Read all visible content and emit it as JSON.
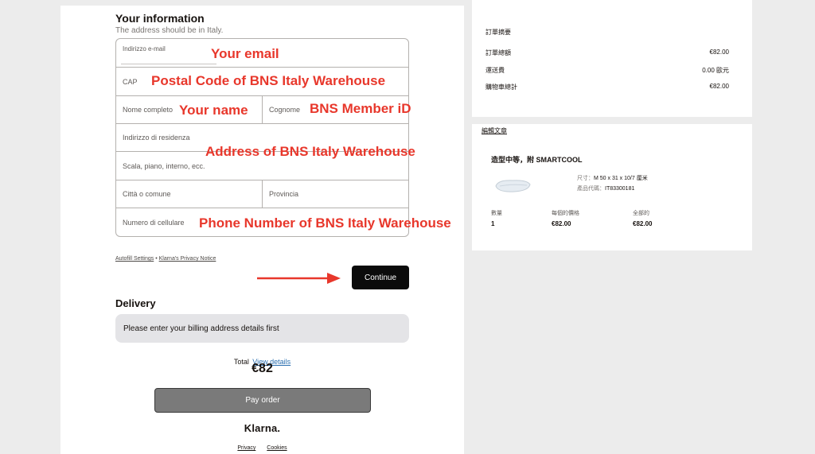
{
  "your_information": {
    "title": "Your information",
    "subtitle": "The address should be in Italy.",
    "fields": {
      "email_label": "Indirizzo e-mail",
      "cap": "CAP",
      "full_name": "Nome completo",
      "surname": "Cognome",
      "residence": "Indirizzo di residenza",
      "scala": "Scala, piano, interno, ecc.",
      "city": "Città o comune",
      "province": "Provincia",
      "phone": "Numero di cellulare"
    }
  },
  "annotations": {
    "email": "Your email",
    "cap": "Postal Code of BNS Italy Warehouse",
    "name": "Your name",
    "member": "BNS Member iD",
    "address": "Address of BNS Italy Warehouse",
    "phone": "Phone Number of BNS Italy Warehouse"
  },
  "links": {
    "autofill": "Autofill Settings",
    "separator": "•",
    "privacy_notice": "Klarna's Privacy Notice"
  },
  "continue_label": "Continue",
  "delivery": {
    "title": "Delivery",
    "notice": "Please enter your billing address details first"
  },
  "total": {
    "label": "Total",
    "view_details": "View details",
    "amount": "€82"
  },
  "pay_label": "Pay order",
  "brand": "Klarna.",
  "footer": {
    "privacy": "Privacy",
    "cookies": "Cookies"
  },
  "summary": {
    "title": "訂單摘要",
    "rows": [
      {
        "label": "訂單總額",
        "value": "€82.00"
      },
      {
        "label": "運送費",
        "value": "0.00 歐元"
      },
      {
        "label": "購物車總計",
        "value": "€82.00"
      }
    ]
  },
  "product": {
    "edit_link": "編輯文章",
    "name": "造型中等，附 SMARTCOOL",
    "size_label": "尺寸：",
    "size_value": "M 50 x 31 x 10/7 厘米",
    "code_label": "產品代碼：",
    "code_value": "IT83300181",
    "headers": {
      "qty": "數量",
      "unit": "每個的價格",
      "total": "全部的"
    },
    "values": {
      "qty": "1",
      "unit": "€82.00",
      "total": "€82.00"
    }
  },
  "colors": {
    "annotation_red": "#e8372b",
    "continue_bg": "#0b0b0b",
    "pay_bg": "#7a7a7a",
    "link_blue": "#2b6fb0"
  }
}
